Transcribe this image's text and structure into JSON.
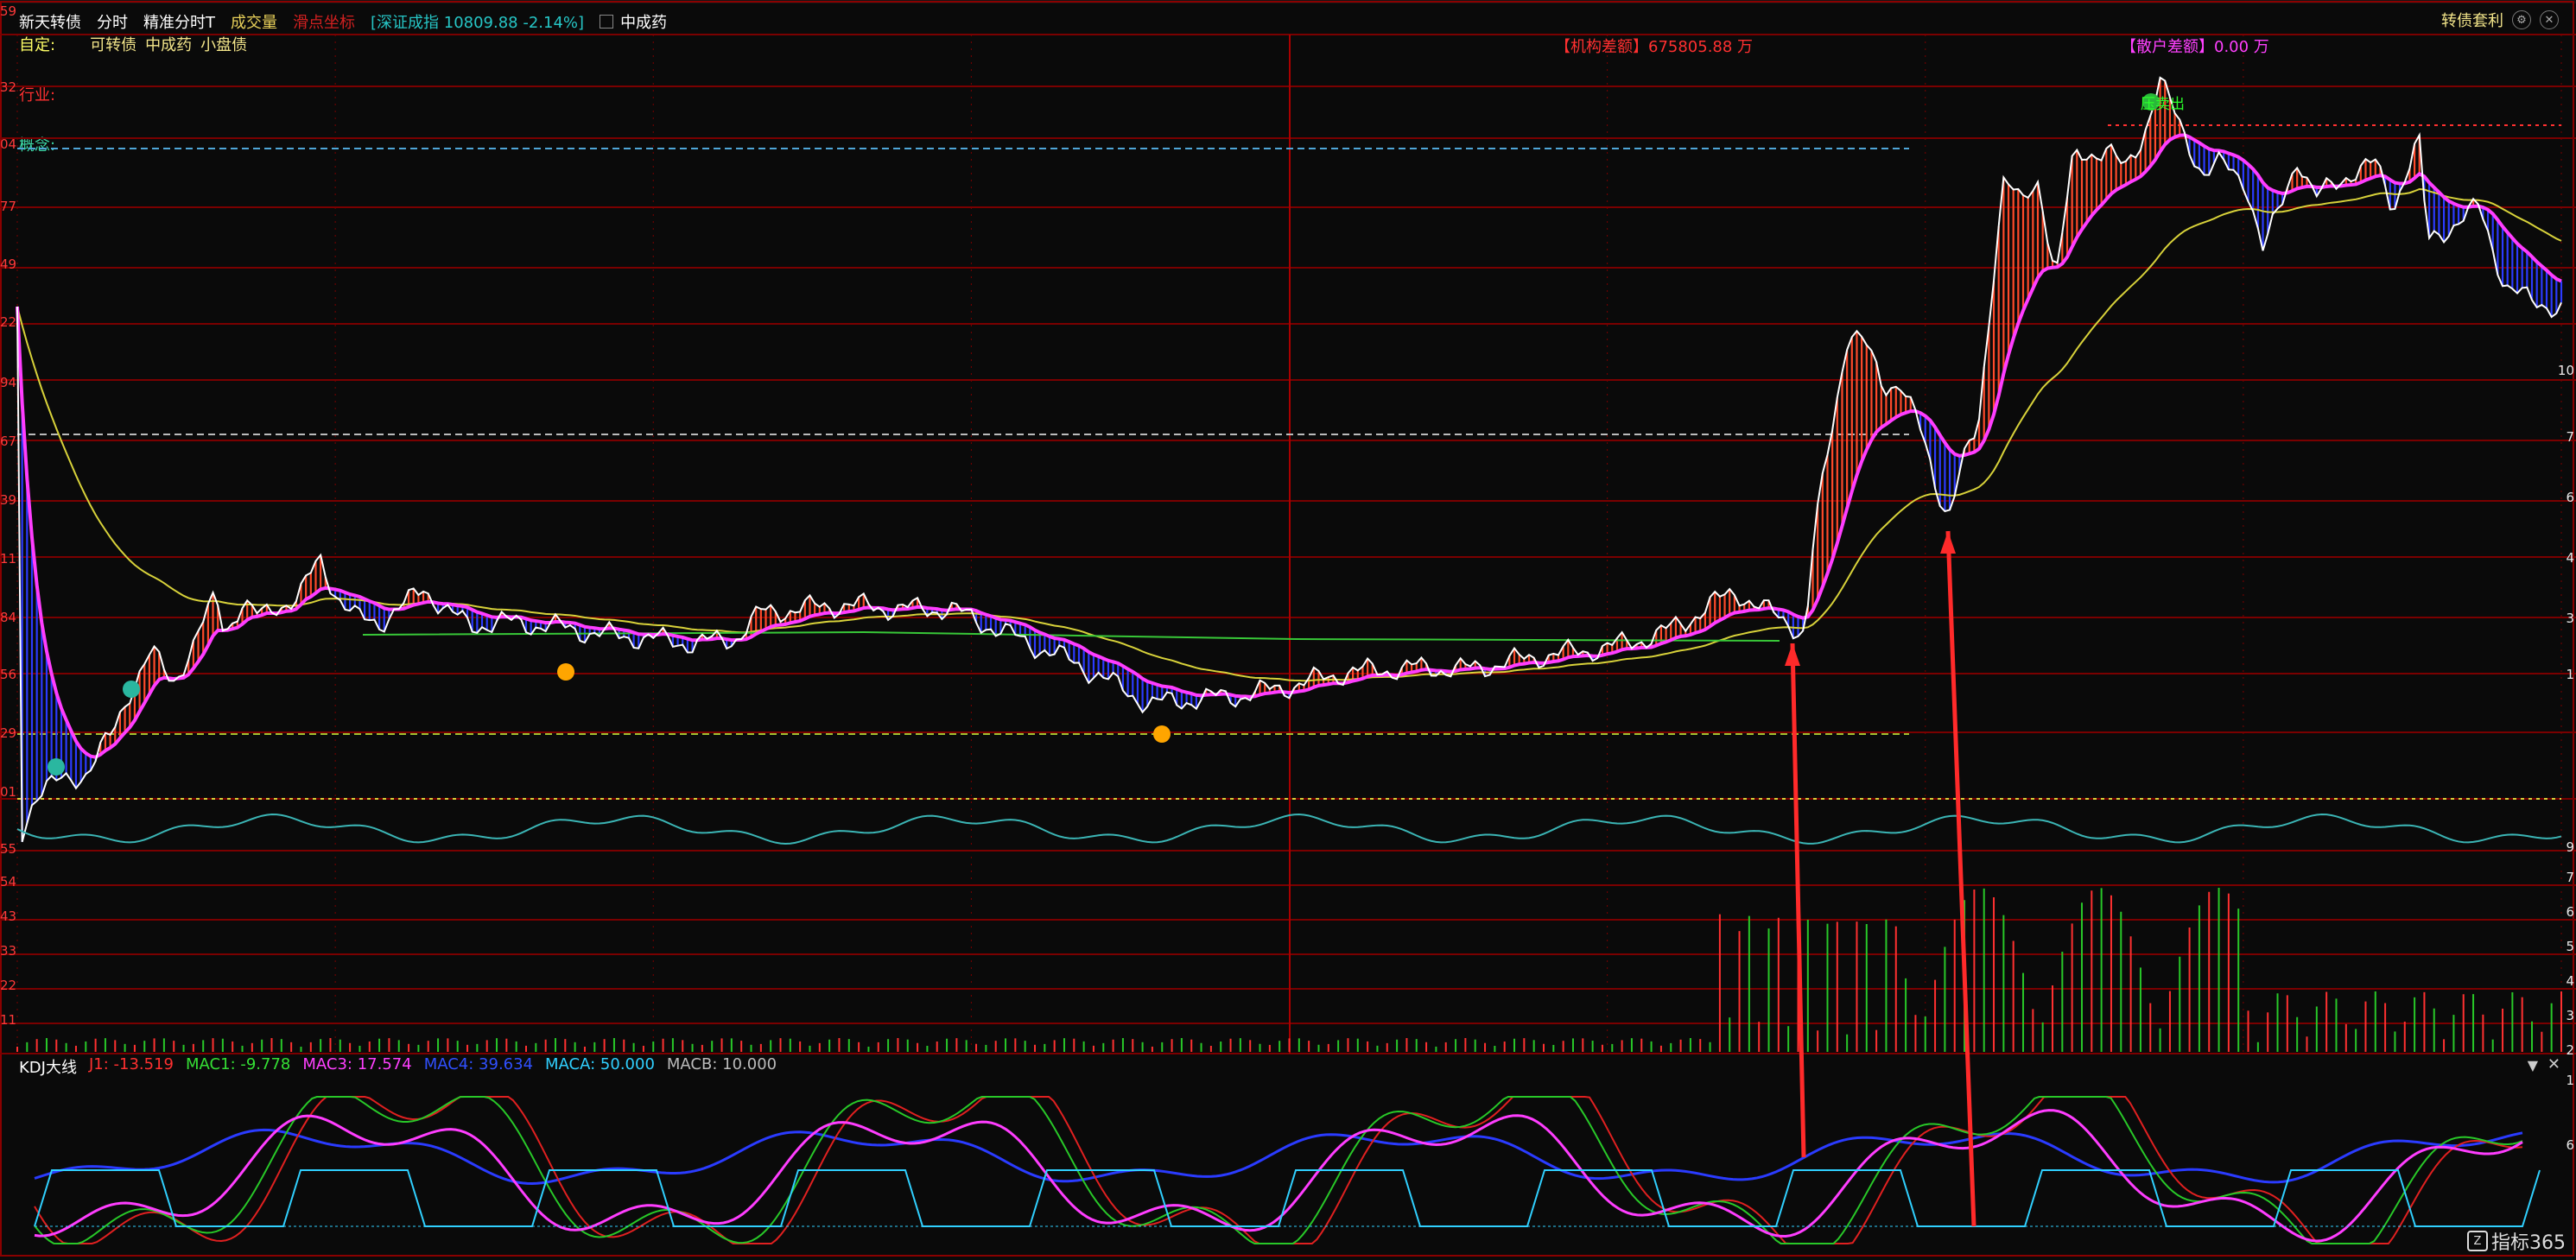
{
  "header": {
    "stock_name": "新天转债",
    "mode": "分时",
    "submode": "精准分时T",
    "volume_label": "成交量",
    "mouse_coords_label": "滑点坐标",
    "index_text": "[深证成指 10809.88 -2.14%]",
    "checkbox_label": "中成药"
  },
  "custom": {
    "label": "自定:",
    "tags": [
      "可转债",
      "中成药",
      "小盘债"
    ]
  },
  "panel_labels": {
    "industry": "行业:",
    "concept": "概念:"
  },
  "fund_flow": {
    "institution": "【机构差额】675805.88 万",
    "retail": "【散户差额】0.00 万"
  },
  "right_toolbar": {
    "arbitrage_label": "转债套利"
  },
  "sell_marker": "压卖出",
  "left_axis_ticks": [
    "59",
    "32",
    "04",
    "77",
    "49",
    "22",
    "94",
    "67",
    "39",
    "11",
    "84",
    "56",
    "29",
    "01",
    "55",
    "54",
    "43",
    "33",
    "22",
    "11"
  ],
  "right_axis_ticks": [
    "10",
    "7",
    "6",
    "4",
    "3",
    "1",
    "9",
    "7",
    "6",
    "5",
    "4",
    "3",
    "2",
    "1",
    "6"
  ],
  "kdj": {
    "title": "KDJ大线",
    "params": [
      {
        "text": "J1: -13.519",
        "color": "#ff3030"
      },
      {
        "text": "MAC1: -9.778",
        "color": "#35e035"
      },
      {
        "text": "MAC3: 17.574",
        "color": "#ff40ff"
      },
      {
        "text": "MAC4: 39.634",
        "color": "#3050ff"
      },
      {
        "text": "MACA: 50.000",
        "color": "#30d0ff"
      },
      {
        "text": "MACB: 10.000",
        "color": "#bbbbbb"
      }
    ]
  },
  "logo_text": "指标365",
  "colors": {
    "up_fill": "#ff4a2a",
    "down_fill": "#2b3bff",
    "price_line": "#ffffff",
    "avg_line": "#ff3dff",
    "slow_line": "#d8d23a",
    "flat_line": "#38c838",
    "cyan_line": "#3bb5b5",
    "grid": "#7a0000",
    "arrow": "#ff2a2a"
  }
}
